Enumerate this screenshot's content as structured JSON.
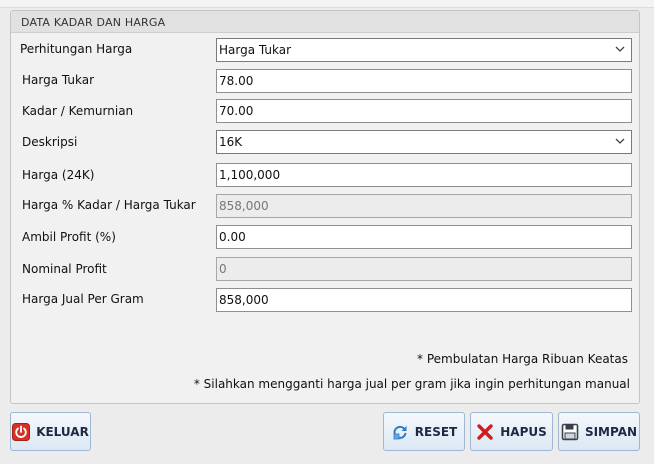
{
  "group": {
    "title": "DATA KADAR DAN HARGA"
  },
  "fields": [
    {
      "label": "Perhitungan Harga",
      "value": "Harga Tukar",
      "type": "select"
    },
    {
      "label": "Harga Tukar",
      "value": "78.00",
      "type": "text"
    },
    {
      "label": "Kadar / Kemurnian",
      "value": "70.00",
      "type": "text"
    },
    {
      "label": "Deskripsi",
      "value": "16K",
      "type": "select"
    },
    {
      "label": "Harga (24K)",
      "value": "1,100,000",
      "type": "text"
    },
    {
      "label": "Harga % Kadar / Harga Tukar",
      "value": "858,000",
      "type": "readonly"
    },
    {
      "label": "Ambil Profit (%)",
      "value": "0.00",
      "type": "text"
    },
    {
      "label": "Nominal Profit",
      "value": "0",
      "type": "readonly"
    },
    {
      "label": "Harga Jual Per Gram",
      "value": "858,000",
      "type": "text"
    }
  ],
  "notes": [
    "* Pembulatan Harga Ribuan Keatas",
    "* Silahkan mengganti harga jual per gram jika ingin perhitungan manual"
  ],
  "buttons": {
    "keluar": "KELUAR",
    "reset": "RESET",
    "hapus": "HAPUS",
    "simpan": "SIMPAN"
  },
  "colors": {
    "keluar_icon": "#d93025",
    "hapus_icon": "#d01c1c",
    "reset_icon": "#2e7bc4",
    "simpan_icon": "#3a3f4a",
    "button_border": "#9fb7d3"
  },
  "icons": {
    "keluar": "power-icon",
    "reset": "refresh-icon",
    "hapus": "x-icon",
    "simpan": "floppy-disk-icon",
    "dropdown": "chevron-down-icon"
  }
}
